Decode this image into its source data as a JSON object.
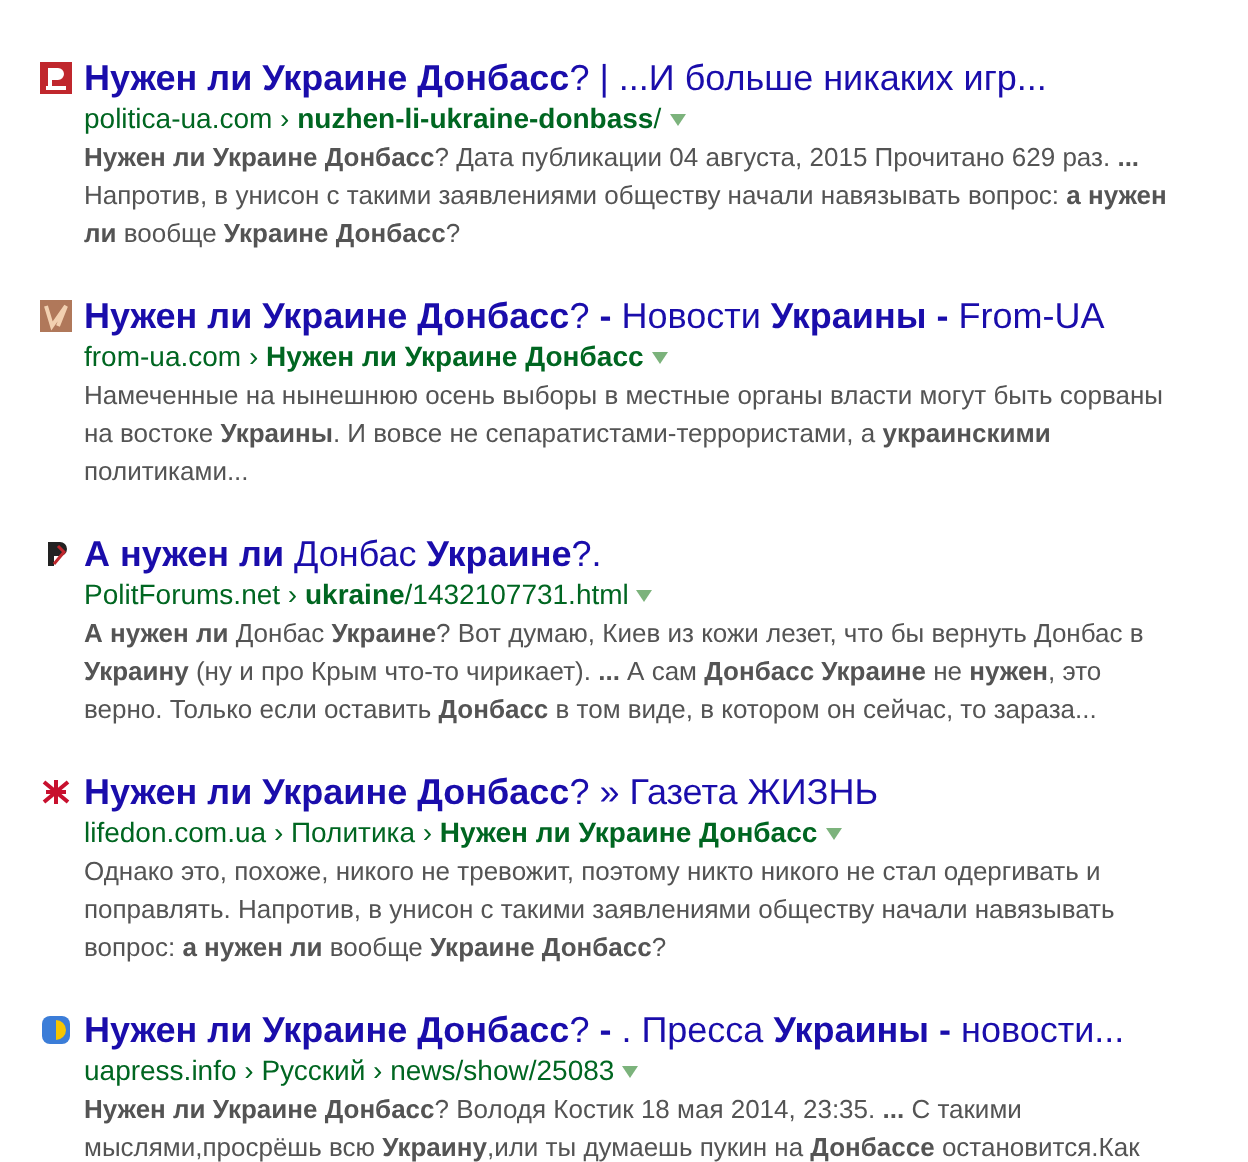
{
  "results": [
    {
      "title": "**Нужен ли Украине Донбасс**? | ...И больше никаких игр...",
      "url": "politica-ua.com › **nuzhen-li-ukraine-donbass**/",
      "snippet": "**Нужен ли Украине Донбасс**? Дата публикации 04 августа, 2015 Прочитано 629 раз. **...** Напротив, в унисон с такими заявлениями обществу начали навязывать вопрос: **а нужен ли** вообще **Украине Донбасс**?"
    },
    {
      "title": "**Нужен ли Украине Донбасс**? **-** Новости **Украины -** From-UA",
      "url": "from-ua.com › **Нужен ли Украине Донбасс**",
      "snippet": "Намеченные на нынешнюю осень выборы в местные органы власти могут быть сорваны на востоке **Украины**. И вовсе не сепаратистами-террористами, а **украинскими** политиками..."
    },
    {
      "title": "**А нужен ли** Донбас **Украине**?.",
      "url": "PolitForums.net › **ukraine**/1432107731.html",
      "snippet": "**А нужен ли** Донбас **Украине**? Вот думаю, Киев из кожи лезет, что бы вернуть Донбас в **Украину** (ну и про Крым что-то чирикает). **...** А сам **Донбасс Украине** не **нужен**, это верно. Только если оставить **Донбасс** в том виде, в котором он сейчас, то зараза..."
    },
    {
      "title": "**Нужен ли Украине Донбасс**? » Газета ЖИЗНЬ",
      "url": "lifedon.com.ua › Политика › **Нужен ли Украине Донбасс**",
      "snippet": "Однако это, похоже, никого не тревожит, поэтому никто никого не стал одергивать и поправлять. Напротив, в унисон с такими заявлениями обществу начали навязывать вопрос: **а нужен ли** вообще **Украине Донбасс**?"
    },
    {
      "title": "**Нужен ли Украине Донбасс**? **-** . Пресса **Украины -** новости...",
      "url": "uapress.info › Русский › news/show/25083",
      "snippet": "**Нужен ли Украине Донбасс**? Володя Костик 18 мая 2014, 23:35. **...** С такими мыслями,просрёшь всю **Украину**,или ты думаешь пукин на **Донбассе** остановится.Как"
    }
  ]
}
